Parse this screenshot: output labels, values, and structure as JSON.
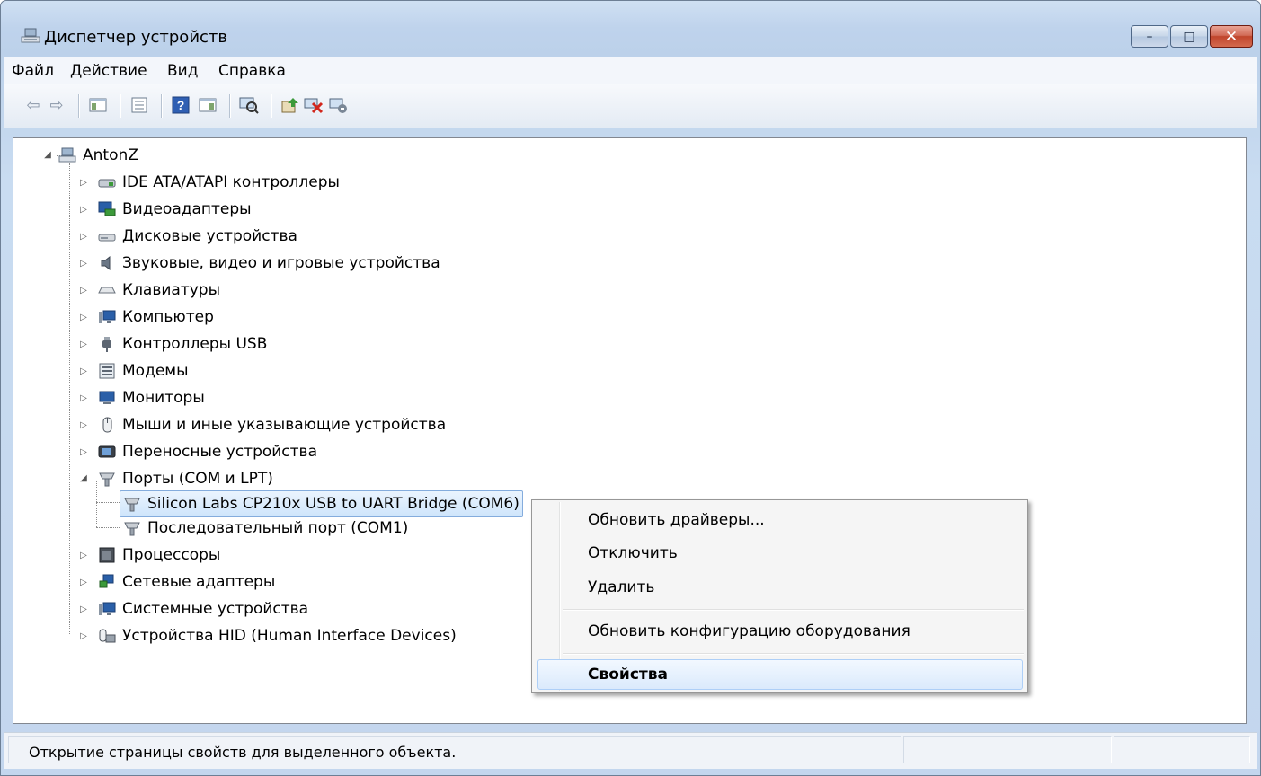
{
  "window": {
    "title": "Диспетчер устройств",
    "minimize": "–",
    "maximize": "□",
    "close": "✕"
  },
  "menu": [
    "Файл",
    "Действие",
    "Вид",
    "Справка"
  ],
  "toolbar": [
    "back-icon",
    "forward-icon",
    "show-hide-tree-icon",
    "properties-icon",
    "help-icon",
    "view-icon",
    "scan-hardware-icon",
    "update-driver-icon",
    "uninstall-icon",
    "disable-icon"
  ],
  "tree": {
    "root": "AntonZ",
    "categories": [
      "IDE ATA/ATAPI контроллеры",
      "Видеоадаптеры",
      "Дисковые устройства",
      "Звуковые, видео и игровые устройства",
      "Клавиатуры",
      "Компьютер",
      "Контроллеры USB",
      "Модемы",
      "Мониторы",
      "Мыши и иные указывающие устройства",
      "Переносные устройства",
      "Порты (COM и LPT)"
    ],
    "ports_children": [
      "Silicon Labs CP210x USB to UART Bridge (COM6)",
      "Последовательный порт (COM1)"
    ],
    "categories_after": [
      "Процессоры",
      "Сетевые адаптеры",
      "Системные устройства",
      "Устройства HID (Human Interface Devices)"
    ]
  },
  "context_menu": {
    "update": "Обновить драйверы...",
    "disable": "Отключить",
    "delete": "Удалить",
    "scan": "Обновить конфигурацию оборудования",
    "properties": "Свойства"
  },
  "status": {
    "text": "Открытие страницы свойств для выделенного объекта."
  }
}
